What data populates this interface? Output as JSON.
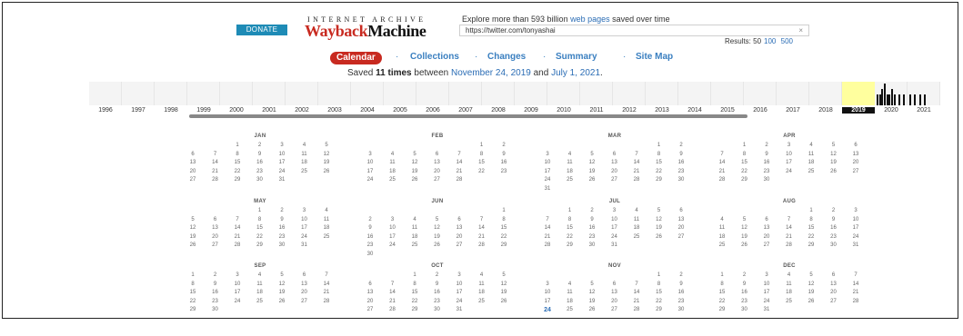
{
  "header": {
    "donate_label": "DONATE",
    "ia_text": "INTERNET ARCHIVE",
    "logo_part1": "Wayback",
    "logo_part2": "Machine",
    "explore_prefix": "Explore more than 593 billion",
    "explore_link": "web pages",
    "explore_suffix": "saved over time",
    "url_value": "https://twitter.com/tonyashai",
    "clear_icon": "close-icon",
    "results_label": "Results: 50",
    "results_opt1": "100",
    "results_opt2": "500"
  },
  "nav": {
    "tabs": [
      {
        "label": "Calendar",
        "active": true
      },
      {
        "label": "Collections",
        "active": false
      },
      {
        "label": "Changes",
        "active": false
      },
      {
        "label": "Summary",
        "active": false
      },
      {
        "label": "Site Map",
        "active": false
      }
    ],
    "separator": "·"
  },
  "saved": {
    "prefix": "Saved",
    "count": "11 times",
    "middle": "between",
    "start": "November 24, 2019",
    "and": "and",
    "end": "July 1, 2021",
    "period": "."
  },
  "timeline": {
    "years": [
      "1996",
      "1997",
      "1998",
      "1999",
      "2000",
      "2001",
      "2002",
      "2003",
      "2004",
      "2005",
      "2006",
      "2007",
      "2008",
      "2009",
      "2010",
      "2011",
      "2012",
      "2013",
      "2014",
      "2015",
      "2016",
      "2017",
      "2018",
      "2019",
      "2020",
      "2021"
    ],
    "selected_year": "2019",
    "highlight_color": "#ffff9e",
    "capture_counts_2020": [
      1,
      1,
      2,
      3,
      1,
      1,
      2,
      1,
      0,
      1,
      0,
      1
    ],
    "capture_counts_2021": [
      1,
      0,
      1,
      0,
      1,
      0,
      1,
      0,
      0,
      0,
      0,
      0
    ]
  },
  "calendar": {
    "year": "2019",
    "months": [
      {
        "name": "JAN",
        "start": 2,
        "days": 31
      },
      {
        "name": "FEB",
        "start": 5,
        "days": 28
      },
      {
        "name": "MAR",
        "start": 5,
        "days": 31
      },
      {
        "name": "APR",
        "start": 1,
        "days": 30
      },
      {
        "name": "MAY",
        "start": 3,
        "days": 31
      },
      {
        "name": "JUN",
        "start": 6,
        "days": 30
      },
      {
        "name": "JUL",
        "start": 1,
        "days": 31
      },
      {
        "name": "AUG",
        "start": 4,
        "days": 31
      },
      {
        "name": "SEP",
        "start": 0,
        "days": 30
      },
      {
        "name": "OCT",
        "start": 2,
        "days": 31
      },
      {
        "name": "NOV",
        "start": 5,
        "days": 30
      },
      {
        "name": "DEC",
        "start": 0,
        "days": 31
      }
    ],
    "captured": [
      {
        "month": "NOV",
        "day": 24
      }
    ]
  },
  "colors": {
    "accent": "#2b6db5",
    "calendar_tab": "#c82a20",
    "donate": "#1e8bb6"
  }
}
